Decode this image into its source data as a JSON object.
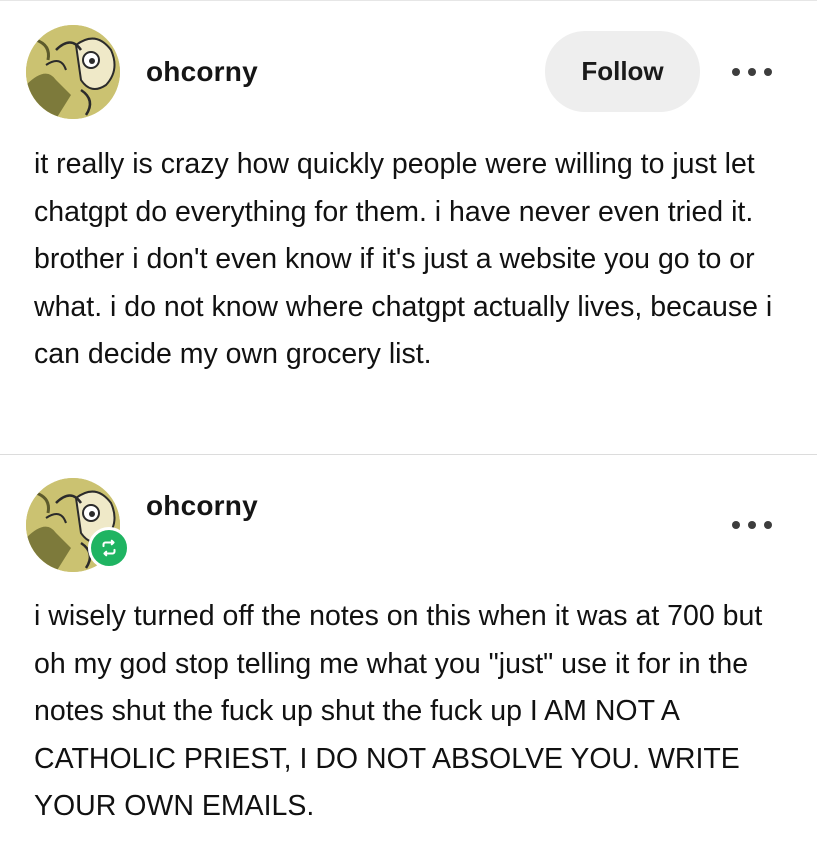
{
  "posts": [
    {
      "username": "ohcorny",
      "follow_label": "Follow",
      "body": "it really is crazy how quickly people were willing to just let chatgpt do everything for them. i have never even tried it. brother i don't even know if it's just a website you go to or what. i do not know where chatgpt actually lives, because i can decide my own grocery list."
    },
    {
      "username": "ohcorny",
      "reblog_icon": "reblog-icon",
      "body": "i wisely turned off the notes on this when it was at 700 but oh my god stop telling me what you \"just\" use it for in the notes shut the fuck up shut the fuck up I AM NOT A CATHOLIC PRIEST, I DO NOT ABSOLVE YOU. WRITE YOUR OWN EMAILS."
    }
  ],
  "colors": {
    "avatar_background": "#c9c16d",
    "follow_button_bg": "#eeeeee",
    "reblog_badge": "#1fb462"
  }
}
